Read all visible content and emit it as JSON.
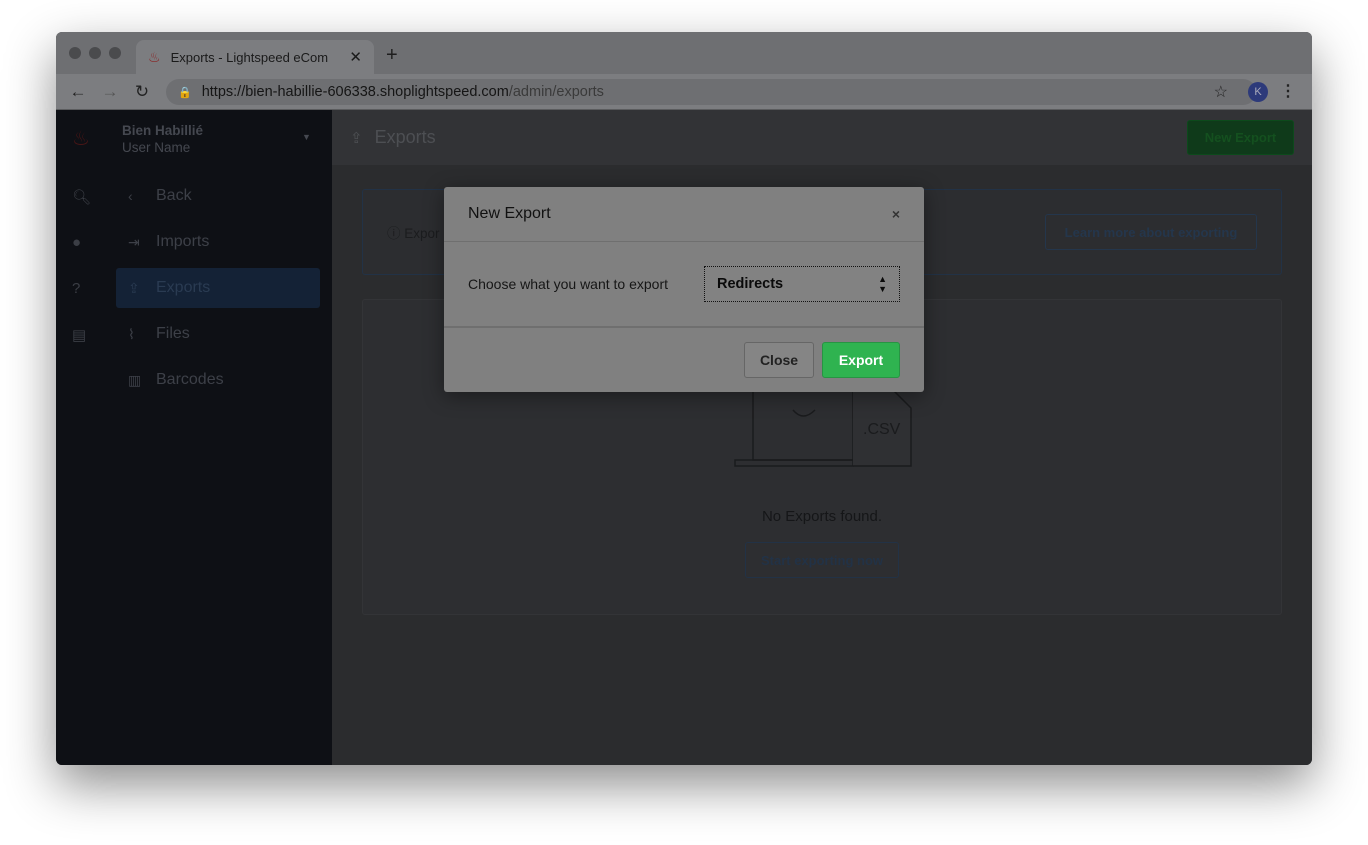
{
  "browser": {
    "tab_title": "Exports - Lightspeed eCom",
    "url_host": "https://bien-habillie-606338.shoplightspeed.com",
    "url_path": "/admin/exports",
    "profile_initial": "K"
  },
  "sidebar": {
    "store_name": "Bien Habillié",
    "user_name": "User Name",
    "items": [
      {
        "label": "Back",
        "icon": "chevron-left-icon"
      },
      {
        "label": "Imports",
        "icon": "import-icon"
      },
      {
        "label": "Exports",
        "icon": "export-icon",
        "active": true
      },
      {
        "label": "Files",
        "icon": "paperclip-icon"
      },
      {
        "label": "Barcodes",
        "icon": "barcode-icon"
      }
    ]
  },
  "header": {
    "title": "Exports",
    "new_export": "New Export"
  },
  "info": {
    "text": "Expor",
    "learn_more": "Learn more about exporting"
  },
  "empty": {
    "csv": ".CSV",
    "message": "No Exports found.",
    "start": "Start exporting now"
  },
  "modal": {
    "title": "New Export",
    "label": "Choose what you want to export",
    "selected": "Redirects",
    "close": "Close",
    "export": "Export"
  },
  "colors": {
    "accent_green": "#2fb350",
    "sidebar": "#0e1015"
  }
}
